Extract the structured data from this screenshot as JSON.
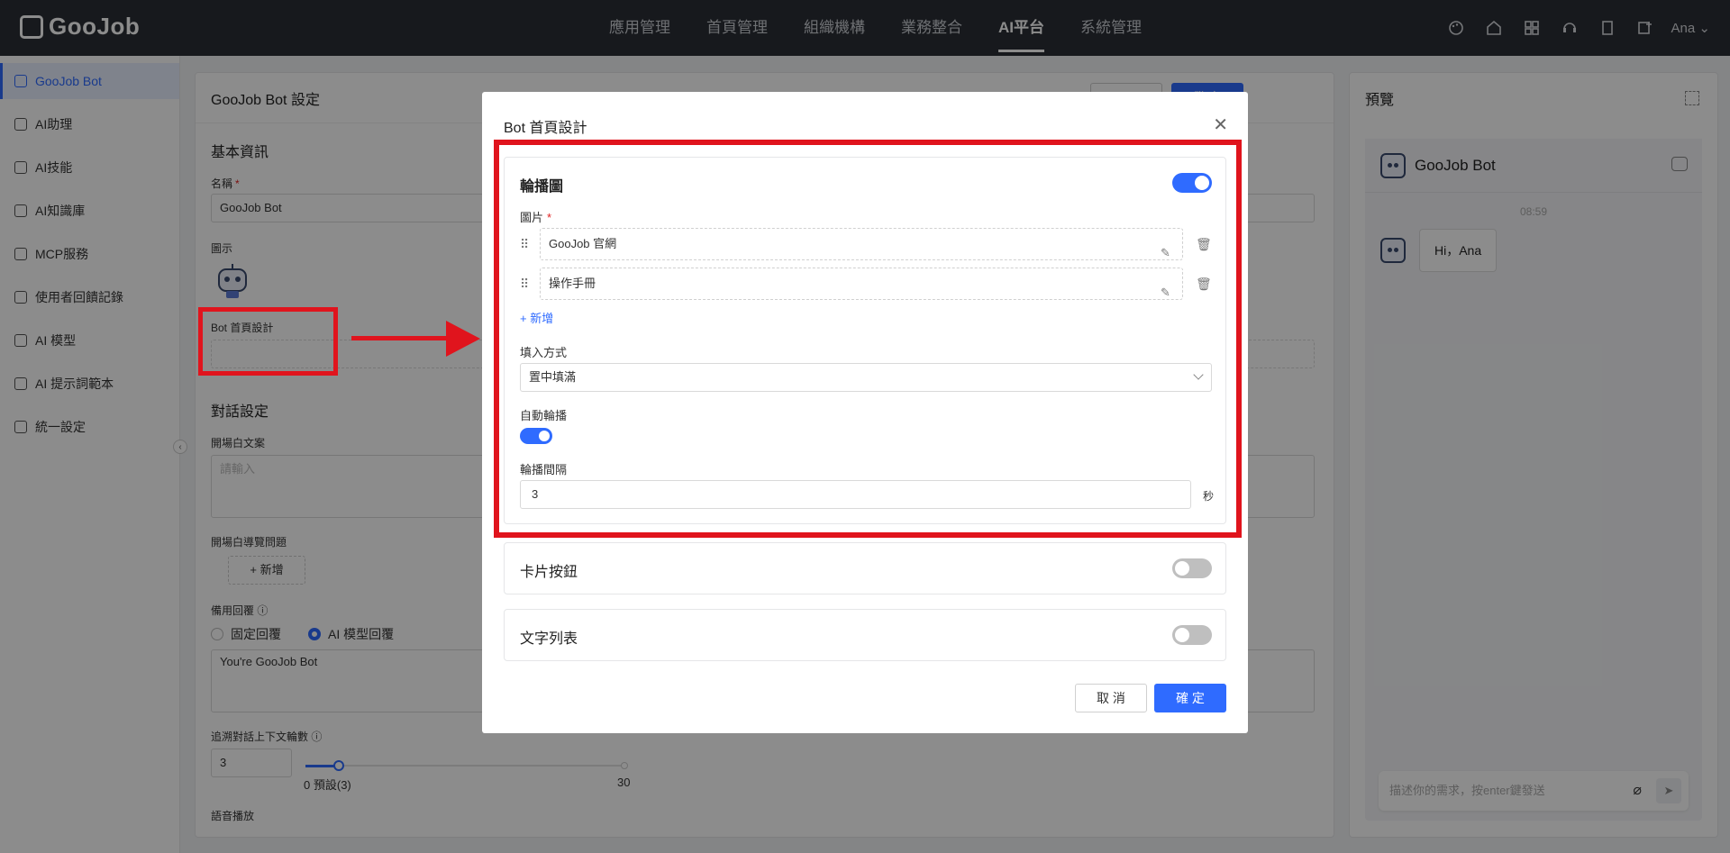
{
  "app": {
    "logo_text": "GooJob"
  },
  "nav": {
    "items": [
      "應用管理",
      "首頁管理",
      "組織機構",
      "業務整合",
      "AI平台",
      "系統管理"
    ],
    "active": "AI平台",
    "user": "Ana",
    "icons": [
      "palette-icon",
      "home-icon",
      "apps-icon",
      "support-icon",
      "book-icon",
      "add-image-icon"
    ]
  },
  "sidebar": {
    "items": [
      {
        "label": "GooJob Bot",
        "icon": "robot-icon",
        "active": true
      },
      {
        "label": "AI助理",
        "icon": "grid-icon"
      },
      {
        "label": "AI技能",
        "icon": "user-icon"
      },
      {
        "label": "AI知識庫",
        "icon": "book-icon"
      },
      {
        "label": "MCP服務",
        "icon": "layers-icon"
      },
      {
        "label": "使用者回饋記錄",
        "icon": "feedback-icon"
      },
      {
        "label": "AI 模型",
        "icon": "cube-icon"
      },
      {
        "label": "AI 提示詞範本",
        "icon": "wand-icon"
      },
      {
        "label": "統一設定",
        "icon": "tools-icon"
      }
    ]
  },
  "main": {
    "title": "GooJob Bot 設定",
    "publish_label": "發 布",
    "basic_info": "基本資訊",
    "name_label": "名稱",
    "name_value": "GooJob Bot",
    "icon_label": "圖示",
    "home_design_label": "Bot 首頁設計",
    "dialog_settings": "對話設定",
    "opening_text_label": "開場白文案",
    "opening_text_placeholder": "請輸入",
    "opening_guide_label": "開場白導覽問題",
    "add_label": "+ 新增",
    "fallback_label": "備用回覆",
    "fallback_options": [
      "固定回覆",
      "AI 模型回覆"
    ],
    "fallback_selected": "AI 模型回覆",
    "prompt_value": "You're GooJob Bot",
    "context_rounds_label": "追溯對話上下文輪數",
    "context_rounds_value": "3",
    "slider_min": "0",
    "slider_default": "預設(3)",
    "slider_max": "30",
    "voice_label": "語音播放"
  },
  "preview": {
    "title": "預覽",
    "bot_name": "GooJob Bot",
    "time": "08:59",
    "greeting": "Hi，Ana",
    "input_placeholder": "描述你的需求，按enter鍵發送"
  },
  "modal": {
    "title": "Bot 首頁設計",
    "carousel_title": "輪播圖",
    "carousel_enabled": true,
    "images_label": "圖片",
    "images": [
      "GooJob 官網",
      "操作手冊"
    ],
    "add_label": "+ 新增",
    "fill_mode_label": "填入方式",
    "fill_mode_value": "置中填滿",
    "autoplay_label": "自動輪播",
    "autoplay_enabled": true,
    "interval_label": "輪播間隔",
    "interval_value": "3",
    "interval_unit": "秒",
    "card_buttons_title": "卡片按鈕",
    "card_buttons_enabled": false,
    "text_list_title": "文字列表",
    "text_list_enabled": false,
    "cancel_label": "取 消",
    "ok_label": "確 定"
  },
  "colors": {
    "accent": "#2f6bff",
    "annotation": "#e0141d",
    "topbar": "#2b2f36"
  }
}
